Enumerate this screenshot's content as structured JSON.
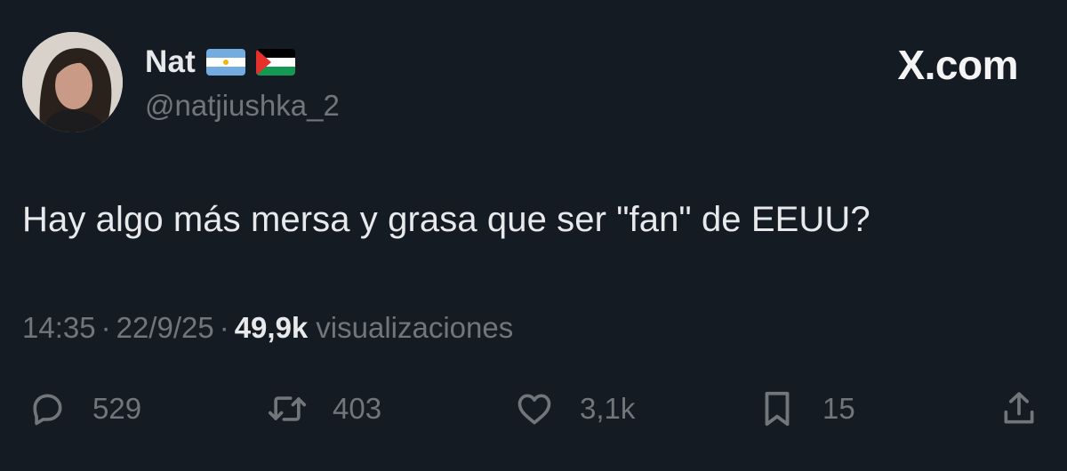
{
  "author": {
    "display_name": "Nat",
    "handle": "@natjiushka_2",
    "flags": [
      "argentina-flag",
      "palestine-flag"
    ]
  },
  "brand": "X.com",
  "tweet": {
    "text": "Hay algo más mersa y grasa que ser \"fan\" de EEUU?"
  },
  "meta": {
    "time": "14:35",
    "separator": "·",
    "date": "22/9/25",
    "views_count": "49,9k",
    "views_label": "visualizaciones"
  },
  "actions": {
    "reply_count": "529",
    "retweet_count": "403",
    "like_count": "3,1k",
    "bookmark_count": "15"
  },
  "icons": {
    "reply": "reply-icon",
    "retweet": "retweet-icon",
    "like": "heart-icon",
    "bookmark": "bookmark-icon",
    "share": "share-icon"
  },
  "colors": {
    "background": "#141b23",
    "primary_text": "#e7e9ea",
    "secondary_text": "#71767b"
  }
}
